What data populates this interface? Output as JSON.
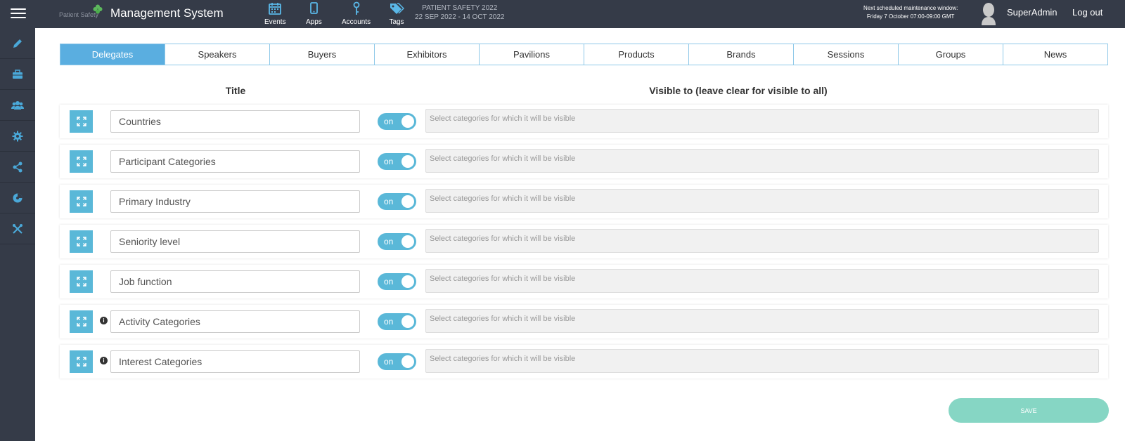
{
  "header": {
    "logo_text": "Patient Safety",
    "app_title": "Management System",
    "nav": [
      {
        "label": "Events",
        "icon": "calendar-icon"
      },
      {
        "label": "Apps",
        "icon": "mobile-icon"
      },
      {
        "label": "Accounts",
        "icon": "key-icon"
      },
      {
        "label": "Tags",
        "icon": "tags-icon"
      }
    ],
    "event_name": "PATIENT SAFETY 2022",
    "event_dates": "22 SEP 2022 - 14 OCT 2022",
    "maintenance_line1": "Next scheduled maintenance window:",
    "maintenance_line2": "Friday 7 October 07:00-09:00 GMT",
    "user": "SuperAdmin",
    "logout": "Log out"
  },
  "sidebar": {
    "items": [
      {
        "icon": "pencil-icon"
      },
      {
        "icon": "briefcase-icon"
      },
      {
        "icon": "users-icon"
      },
      {
        "icon": "gear-icon"
      },
      {
        "icon": "share-icon"
      },
      {
        "icon": "chart-icon"
      },
      {
        "icon": "tools-icon"
      }
    ]
  },
  "tabs": [
    "Delegates",
    "Speakers",
    "Buyers",
    "Exhibitors",
    "Pavilions",
    "Products",
    "Brands",
    "Sessions",
    "Groups",
    "News"
  ],
  "active_tab": "Delegates",
  "columns": {
    "title": "Title",
    "visible": "Visible to (leave clear for visible to all)"
  },
  "rows": [
    {
      "title": "Countries",
      "info": false,
      "toggle": "on",
      "placeholder": "Select categories for which it will be visible"
    },
    {
      "title": "Participant Categories",
      "info": false,
      "toggle": "on",
      "placeholder": "Select categories for which it will be visible"
    },
    {
      "title": "Primary Industry",
      "info": false,
      "toggle": "on",
      "placeholder": "Select categories for which it will be visible"
    },
    {
      "title": "Seniority level",
      "info": false,
      "toggle": "on",
      "placeholder": "Select categories for which it will be visible"
    },
    {
      "title": "Job function",
      "info": false,
      "toggle": "on",
      "placeholder": "Select categories for which it will be visible"
    },
    {
      "title": "Activity Categories",
      "info": true,
      "toggle": "on",
      "placeholder": "Select categories for which it will be visible"
    },
    {
      "title": "Interest Categories",
      "info": true,
      "toggle": "on",
      "placeholder": "Select categories for which it will be visible"
    }
  ],
  "save_label": "SAVE",
  "colors": {
    "topbar": "#353b48",
    "accent": "#5aaee0",
    "toggle": "#5ab8d8",
    "save": "#86d6c4"
  }
}
